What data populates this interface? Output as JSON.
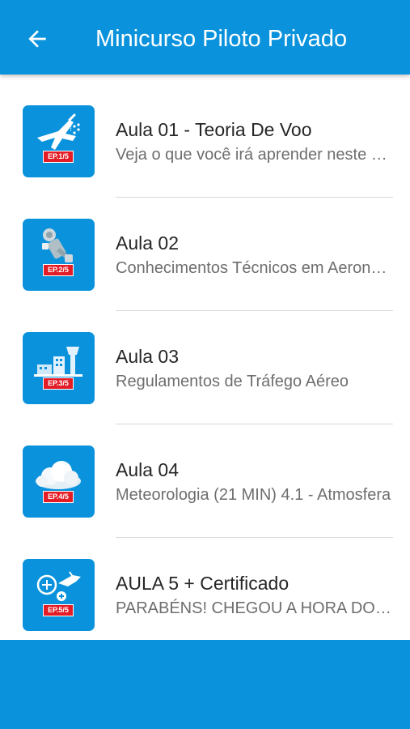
{
  "header": {
    "title": "Minicurso Piloto Privado",
    "back_icon": "arrow-left-icon"
  },
  "colors": {
    "primary": "#0a93dc",
    "badge": "#e31c25",
    "title_text": "#262626",
    "subtitle_text": "#6e6e6e",
    "divider": "#d9d9d9"
  },
  "lessons": [
    {
      "title": "Aula 01 - Teoria De Voo",
      "subtitle": "Veja o que você irá aprender neste curso",
      "badge": "EP.1/5",
      "icon": "airplane-icon"
    },
    {
      "title": "Aula 02",
      "subtitle": "Conhecimentos Técnicos em Aeronaves",
      "badge": "EP.2/5",
      "icon": "engine-icon"
    },
    {
      "title": "Aula 03",
      "subtitle": "Regulamentos de Tráfego Aéreo",
      "badge": "EP.3/5",
      "icon": "control-tower-icon"
    },
    {
      "title": "Aula 04",
      "subtitle": "Meteorologia (21 MIN)  4.1 - Atmosfera",
      "badge": "EP.4/5",
      "icon": "cloud-icon"
    },
    {
      "title": "AULA 5 + Certificado",
      "subtitle": "PARABÉNS! CHEGOU A HORA DO CERTIFICADO",
      "badge": "EP.5/5",
      "icon": "navigation-icon"
    }
  ]
}
